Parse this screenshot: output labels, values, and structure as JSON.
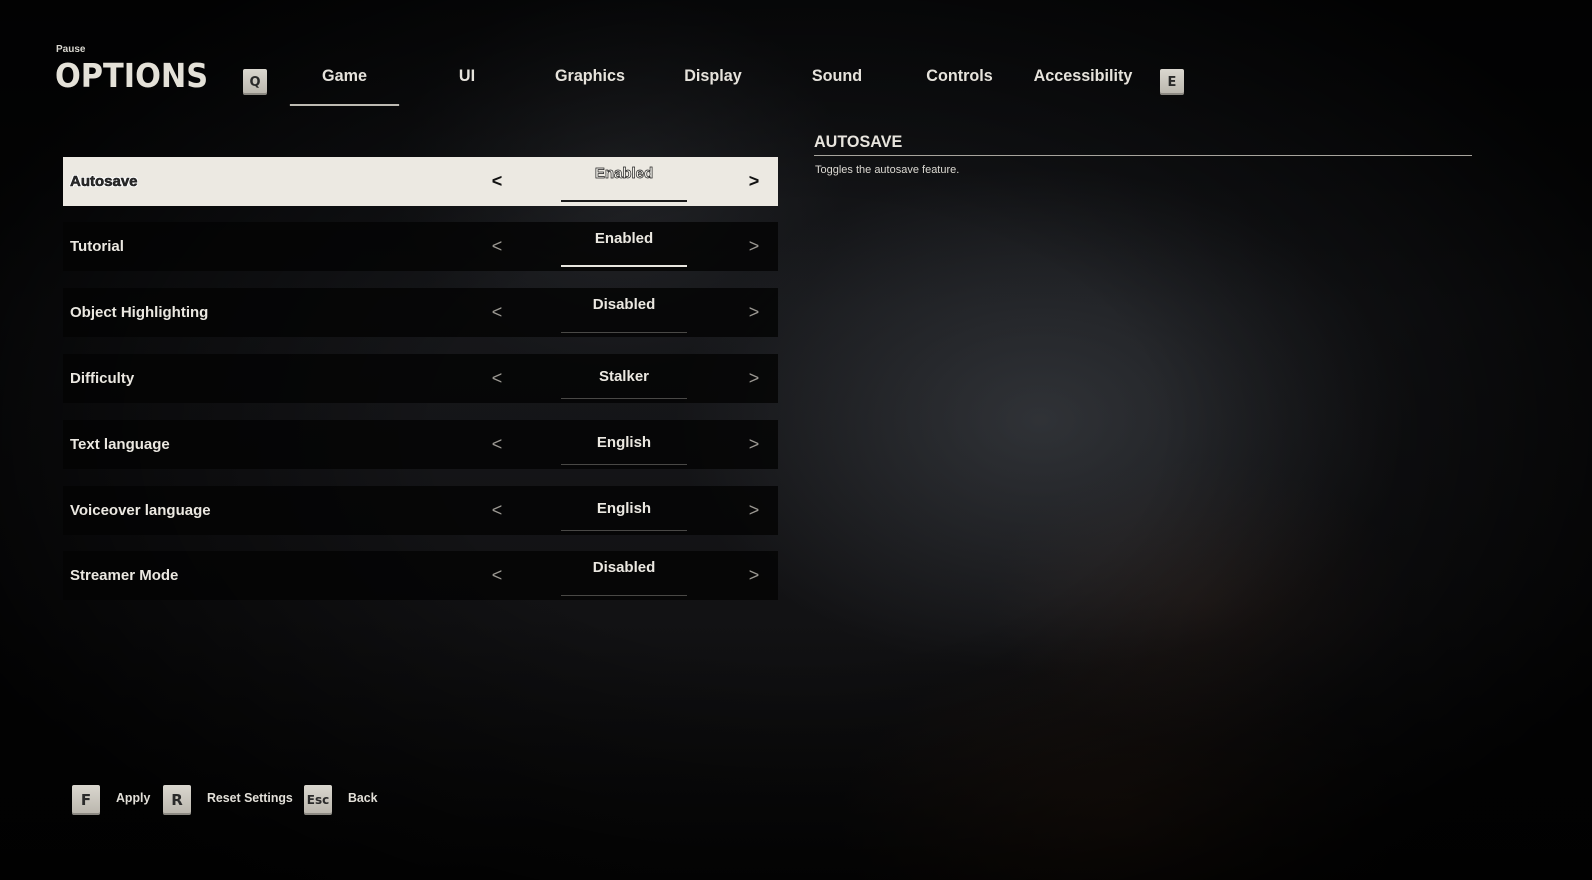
{
  "header": {
    "pause_label": "Pause",
    "title": "OPTIONS",
    "prev_key": "Q",
    "next_key": "E"
  },
  "tabs": [
    {
      "label": "Game",
      "active": true
    },
    {
      "label": "UI",
      "active": false
    },
    {
      "label": "Graphics",
      "active": false
    },
    {
      "label": "Display",
      "active": false
    },
    {
      "label": "Sound",
      "active": false
    },
    {
      "label": "Controls",
      "active": false
    },
    {
      "label": "Accessibility",
      "active": false
    }
  ],
  "settings": [
    {
      "label": "Autosave",
      "value": "Enabled",
      "selected": true
    },
    {
      "label": "Tutorial",
      "value": "Enabled",
      "selected": false
    },
    {
      "label": "Object Highlighting",
      "value": "Disabled",
      "selected": false
    },
    {
      "label": "Difficulty",
      "value": "Stalker",
      "selected": false
    },
    {
      "label": "Text language",
      "value": "English",
      "selected": false
    },
    {
      "label": "Voiceover language",
      "value": "English",
      "selected": false
    },
    {
      "label": "Streamer Mode",
      "value": "Disabled",
      "selected": false
    }
  ],
  "arrows": {
    "prev": "<",
    "next": ">"
  },
  "description": {
    "title": "AUTOSAVE",
    "text": "Toggles the autosave feature."
  },
  "footer": [
    {
      "key": "F",
      "label": "Apply"
    },
    {
      "key": "R",
      "label": "Reset Settings"
    },
    {
      "key": "Esc",
      "label": "Back"
    }
  ],
  "colors": {
    "selected_row_bg": "#ece9e2",
    "row_bg": "#040404",
    "text": "#ebe8e1",
    "keycap": "#d0cdc5"
  }
}
